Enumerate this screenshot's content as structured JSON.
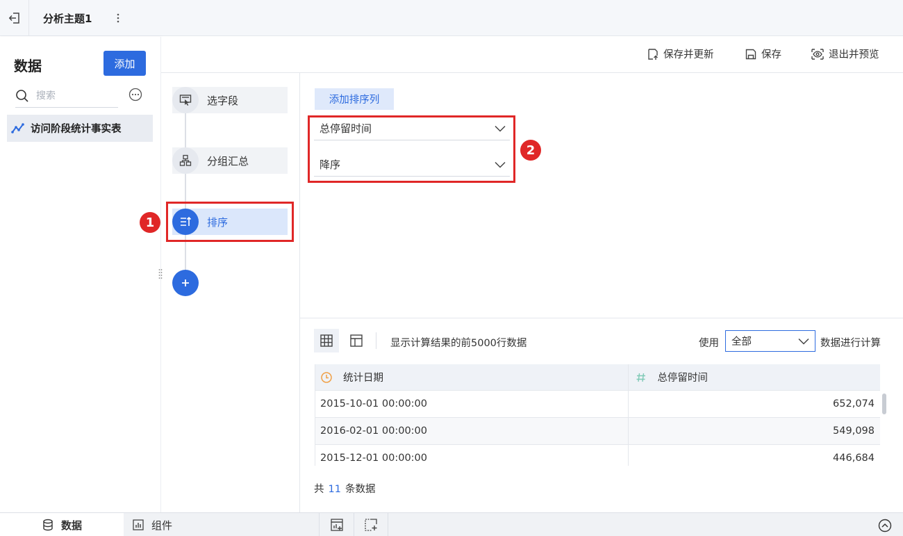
{
  "topbar": {
    "title": "分析主题1"
  },
  "left_panel": {
    "title": "数据",
    "add_label": "添加",
    "search_placeholder": "搜索",
    "table_name": "访问阶段统计事实表"
  },
  "header": {
    "save_update_label": "保存并更新",
    "save_label": "保存",
    "exit_preview_label": "退出并预览"
  },
  "steps": [
    {
      "label": "选字段",
      "icon": "select-field-icon",
      "active": false
    },
    {
      "label": "分组汇总",
      "icon": "group-summary-icon",
      "active": false
    },
    {
      "label": "排序",
      "icon": "sort-icon",
      "active": true
    }
  ],
  "sort": {
    "add_button": "添加排序列",
    "field_value": "总停留时间",
    "order_value": "降序"
  },
  "annotations": {
    "badge_1": "1",
    "badge_2": "2"
  },
  "preview": {
    "note": "显示计算结果的前5000行数据",
    "use_label": "使用",
    "use_value": "全部",
    "calc_label": "数据进行计算",
    "columns": [
      {
        "name": "统计日期",
        "type_icon": "clock-icon"
      },
      {
        "name": "总停留时间",
        "type_icon": "hash-icon"
      }
    ],
    "rows": [
      [
        "2015-10-01 00:00:00",
        "652,074"
      ],
      [
        "2016-02-01 00:00:00",
        "549,098"
      ],
      [
        "2015-12-01 00:00:00",
        "446,684"
      ]
    ],
    "total_prefix": "共",
    "total_count": "11",
    "total_suffix": "条数据"
  },
  "bottom": {
    "tab_data": "数据",
    "tab_component": "组件"
  },
  "colors": {
    "accent": "#2d6bdf",
    "annotation_red": "#e02727"
  }
}
